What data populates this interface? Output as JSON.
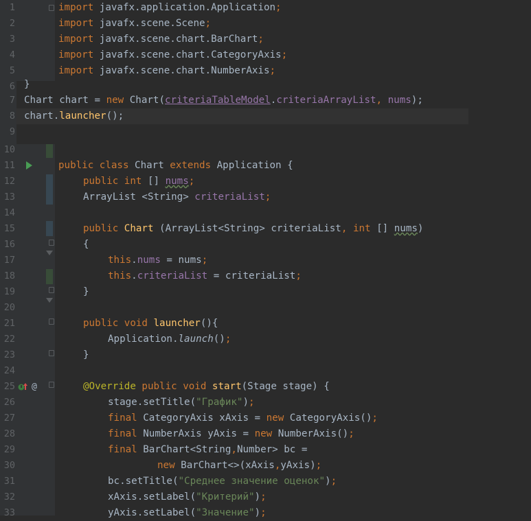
{
  "editor": {
    "line_numbers": [
      "1",
      "2",
      "3",
      "4",
      "5",
      "6",
      "7",
      "8",
      "9",
      "10",
      "11",
      "12",
      "13",
      "14",
      "15",
      "16",
      "17",
      "18",
      "19",
      "20",
      "21",
      "22",
      "23",
      "24",
      "25",
      "26",
      "27",
      "28",
      "29",
      "30",
      "31",
      "32",
      "33"
    ],
    "gutter_marker_25": "@",
    "imports": [
      {
        "kw": "import",
        "path": " javafx.application.Application",
        "semi": ";"
      },
      {
        "kw": "import",
        "path": " javafx.scene.Scene",
        "semi": ";"
      },
      {
        "kw": "import",
        "path": " javafx.scene.chart.BarChart",
        "semi": ";"
      },
      {
        "kw": "import",
        "path": " javafx.scene.chart.CategoryAxis",
        "semi": ";"
      },
      {
        "kw": "import",
        "path": " javafx.scene.chart.NumberAxis",
        "semi": ";"
      }
    ],
    "sticky": {
      "brace": "}",
      "l7": {
        "a": "Chart chart = ",
        "kw": "new",
        "b": " Chart(",
        "c": "criteriaTableModel",
        "d": ".",
        "e": "criteriaArrayList",
        "f": ", ",
        "g": "nums",
        "h": ");"
      },
      "l8": {
        "a": "chart.",
        "b": "launcher",
        "c": "();"
      }
    },
    "class_decl": {
      "k1": "public class",
      "name": " Chart ",
      "k2": "extends",
      "rest": " Application {"
    },
    "l12": {
      "k1": "public int",
      "a": " [] ",
      "f": "nums",
      "s": ";"
    },
    "l13": {
      "a": "ArrayList <String> ",
      "f": "criteriaList",
      "s": ";"
    },
    "l15": {
      "k1": "public",
      "fn": " Chart",
      "a": " (ArrayList<String> criteriaList",
      "c": ", ",
      "k2": "int",
      "b": " [] ",
      "p": "nums",
      "e": ")"
    },
    "l16": "{",
    "l17": {
      "k": "this",
      "d": ".",
      "f": "nums",
      "r": " = nums",
      "s": ";"
    },
    "l18": {
      "k": "this",
      "d": ".",
      "f": "criteriaList",
      "r": " = criteriaList",
      "s": ";"
    },
    "l19": "}",
    "l21": {
      "k": "public void",
      "fn": " launcher",
      "r": "(){"
    },
    "l22": {
      "a": "Application.",
      "m": "launch",
      "r": "()",
      "s": ";"
    },
    "l23": "}",
    "l25": {
      "ann": "@Override",
      "k": " public void",
      "fn": " start",
      "r": "(Stage stage) {"
    },
    "l26": {
      "a": "stage.setTitle(",
      "str": "\"График\"",
      "r": ")",
      "s": ";"
    },
    "l27": {
      "k": "final",
      "a": " CategoryAxis xAxis = ",
      "k2": "new",
      "r": " CategoryAxis()",
      "s": ";"
    },
    "l28": {
      "k": "final",
      "a": " NumberAxis yAxis = ",
      "k2": "new",
      "r": " NumberAxis()",
      "s": ";"
    },
    "l29": {
      "k": "final",
      "a": " BarChart<String",
      "c": ",",
      "b": "Number> bc ="
    },
    "l30": {
      "k": "new",
      "a": " BarChart<>(xAxis",
      "c": ",",
      "b": "yAxis)",
      "s": ";"
    },
    "l31": {
      "a": "bc.setTitle(",
      "str": "\"Среднее значение оценок\"",
      "r": ")",
      "s": ";"
    },
    "l32": {
      "a": "xAxis.setLabel(",
      "str": "\"Критерий\"",
      "r": ")",
      "s": ";"
    },
    "l33": {
      "a": "yAxis.setLabel(",
      "str": "\"Значение\"",
      "r": ")",
      "s": ";"
    }
  },
  "colors": {
    "background": "#2b2b2b",
    "gutter": "#313335",
    "keyword": "#cc7832",
    "string": "#6a8759",
    "field": "#9876aa",
    "function": "#ffc66d",
    "annotation": "#bbb529",
    "text": "#a9b7c6"
  }
}
